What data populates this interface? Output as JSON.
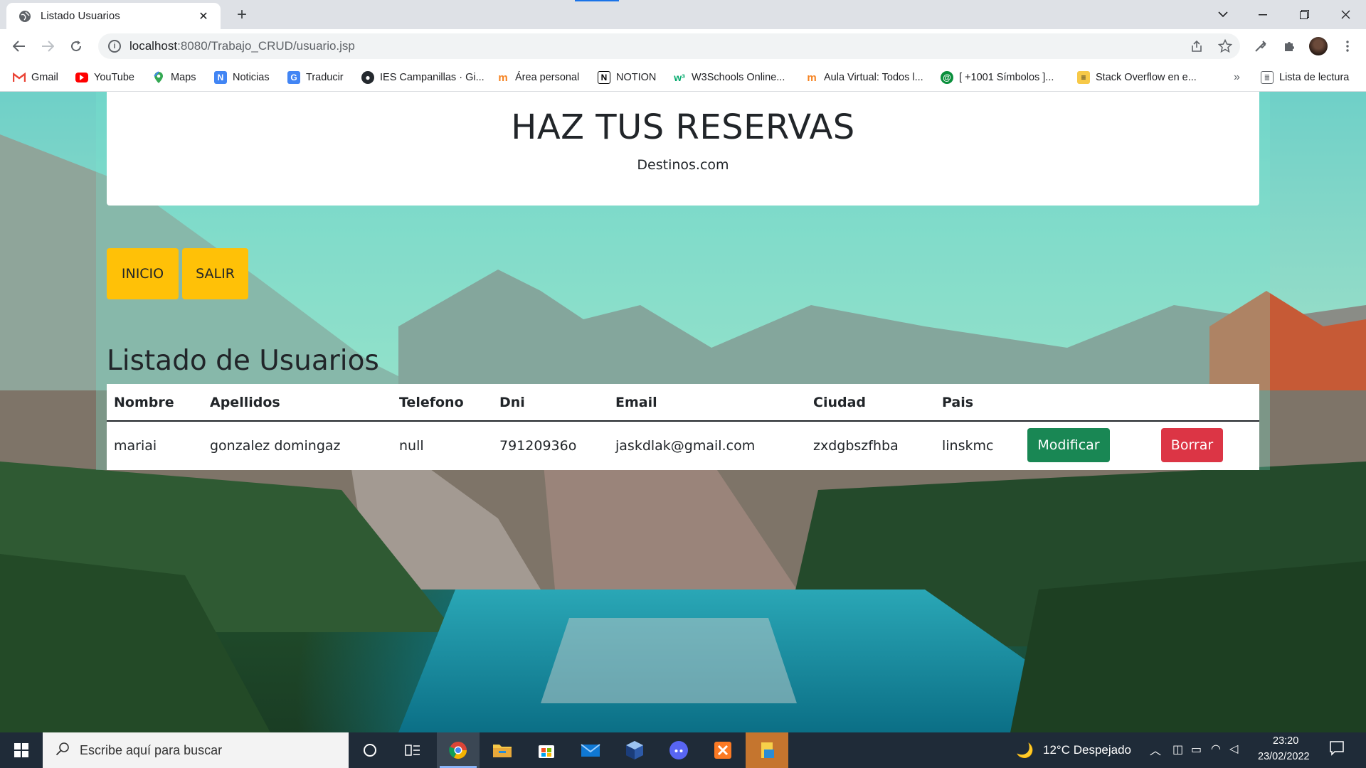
{
  "browser": {
    "tab_title": "Listado Usuarios",
    "tab_close": "✕",
    "new_tab": "+",
    "url_host": "localhost",
    "url_path": ":8080/Trabajo_CRUD/usuario.jsp",
    "bookmarks": [
      "Gmail",
      "YouTube",
      "Maps",
      "Noticias",
      "Traducir",
      "IES Campanillas · Gi...",
      "Área personal",
      "NOTION",
      "W3Schools Online...",
      "Aula Virtual: Todos l...",
      "[ +1001 Símbolos ]...",
      "Stack Overflow en e..."
    ],
    "bookmarks_more": "»",
    "reading_list": "Lista de lectura",
    "colors": {
      "tabbar": "#dee1e6",
      "omnibox": "#f1f3f4"
    }
  },
  "page": {
    "title": "HAZ TUS RESERVAS",
    "subtitle": "Destinos.com",
    "nav": {
      "inicio": "INICIO",
      "salir": "SALIR"
    },
    "list_heading": "Listado de Usuarios",
    "table": {
      "headers": [
        "Nombre",
        "Apellidos",
        "Telefono",
        "Dni",
        "Email",
        "Ciudad",
        "Pais"
      ],
      "rows": [
        [
          "mariai",
          "gonzalez domingaz",
          "null",
          "79120936o",
          "jaskdlak@gmail.com",
          "zxdgbszfhba",
          "linskmc"
        ]
      ],
      "actions": {
        "modify": "Modificar",
        "delete": "Borrar"
      }
    },
    "colors": {
      "nav_button": "#ffc107",
      "modify": "#198754",
      "delete": "#dc3545"
    }
  },
  "taskbar": {
    "search_placeholder": "Escribe aquí para buscar",
    "weather": "12°C  Despejado",
    "time": "23:20",
    "date": "23/02/2022"
  }
}
